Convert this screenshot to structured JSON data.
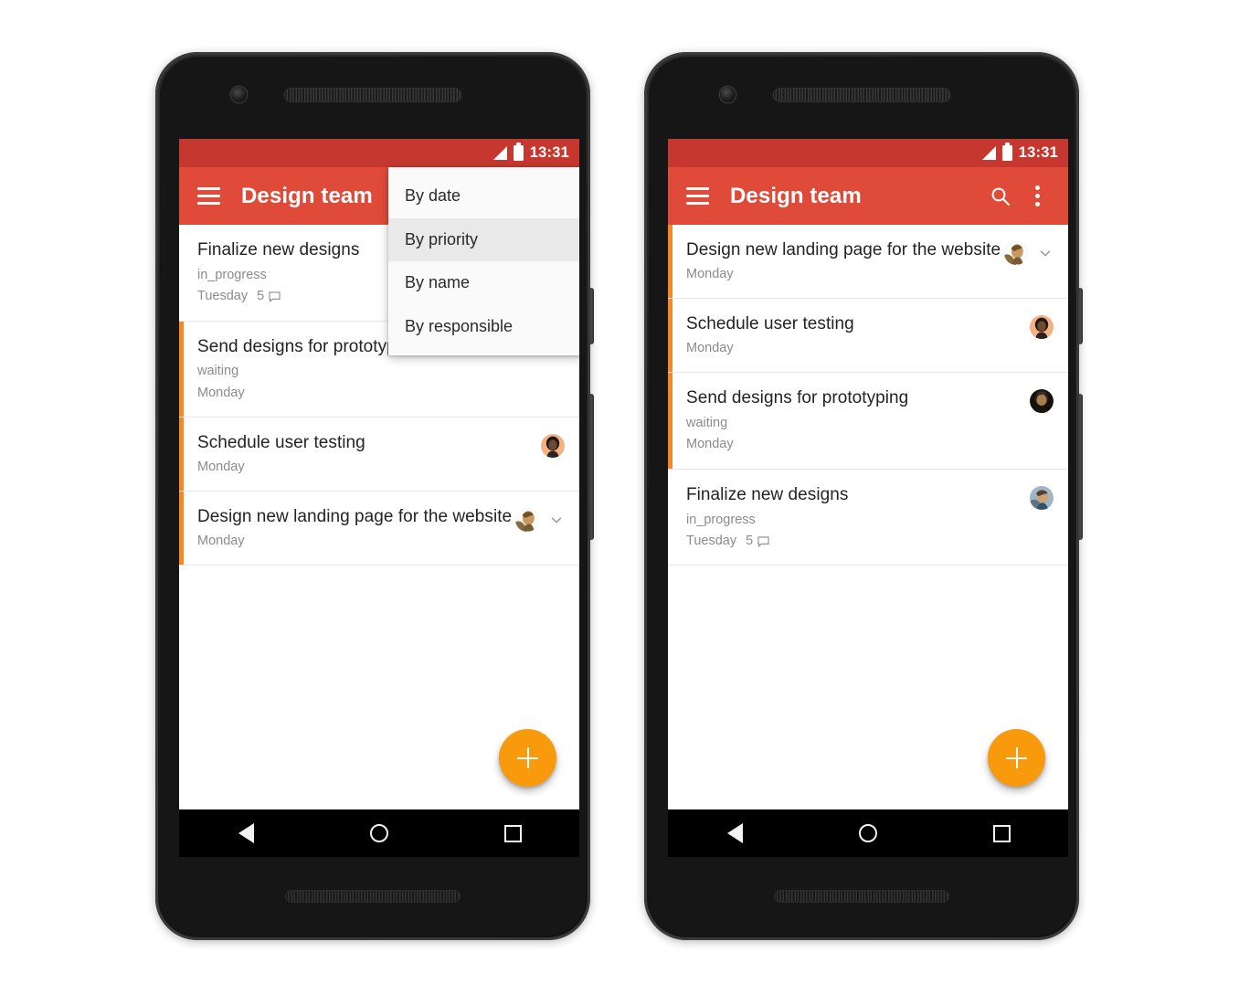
{
  "statusbar": {
    "clock": "13:31",
    "signal_icon": "signal-triangle-icon",
    "battery_icon": "battery-full-icon"
  },
  "appbar": {
    "title": "Design team",
    "menu_icon": "hamburger-menu-icon",
    "search_icon": "search-icon",
    "overflow_icon": "overflow-menu-icon"
  },
  "fab": {
    "label": "+",
    "icon": "plus-icon",
    "color": "#f99a0d"
  },
  "navbar": {
    "back": "back-triangle-icon",
    "home": "home-circle-icon",
    "recents": "recents-square-icon"
  },
  "colors": {
    "statusbar_red": "#c6372f",
    "appbar_red": "#e04b39",
    "priority_stripe_orange": "#f6881f",
    "fab_orange": "#f99a0d",
    "menu_highlight": "#e9e9e9"
  },
  "sort_menu": {
    "visible": true,
    "selected": "By priority",
    "items": [
      {
        "label": "By date",
        "active": false
      },
      {
        "label": "By priority",
        "active": true
      },
      {
        "label": "By name",
        "active": false
      },
      {
        "label": "By responsible",
        "active": false
      }
    ]
  },
  "phone_left": {
    "sort_order": "By date",
    "tasks": [
      {
        "title": "Finalize new designs",
        "status": "in_progress",
        "day": "Tuesday",
        "comments": "5",
        "priority_stripe": false,
        "avatar": "none",
        "chevron": false
      },
      {
        "title": "Send designs for prototyping",
        "status": "waiting",
        "day": "Monday",
        "comments": "",
        "priority_stripe": true,
        "avatar": "none",
        "chevron": false
      },
      {
        "title": "Schedule user testing",
        "status": "",
        "day": "Monday",
        "comments": "",
        "priority_stripe": true,
        "avatar": "woman-peach",
        "chevron": false
      },
      {
        "title": "Design new landing page for the website",
        "status": "",
        "day": "Monday",
        "comments": "",
        "priority_stripe": true,
        "avatar": "person-tan",
        "chevron": true
      }
    ]
  },
  "phone_right": {
    "sort_order": "By priority",
    "tasks": [
      {
        "title": "Design new landing page for the website",
        "status": "",
        "day": "Monday",
        "comments": "",
        "priority_stripe": true,
        "avatar": "person-tan",
        "chevron": true
      },
      {
        "title": "Schedule user testing",
        "status": "",
        "day": "Monday",
        "comments": "",
        "priority_stripe": true,
        "avatar": "woman-peach",
        "chevron": false
      },
      {
        "title": "Send designs for prototyping",
        "status": "waiting",
        "day": "Monday",
        "comments": "",
        "priority_stripe": true,
        "avatar": "person-dark",
        "chevron": false
      },
      {
        "title": "Finalize new designs",
        "status": "in_progress",
        "day": "Tuesday",
        "comments": "5",
        "priority_stripe": false,
        "avatar": "person-blue",
        "chevron": false
      }
    ]
  }
}
